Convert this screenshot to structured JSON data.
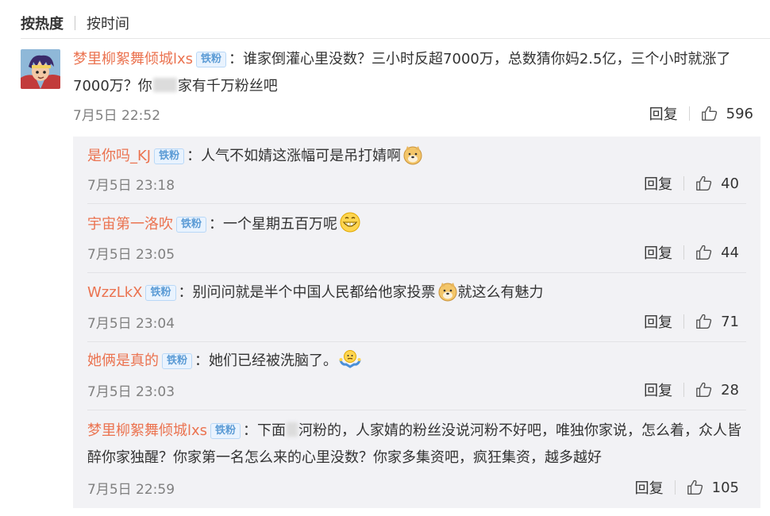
{
  "sort": {
    "hot": "按热度",
    "time": "按时间"
  },
  "main": {
    "avatar_icon": "anime-character-avatar",
    "username": "梦里柳絮舞倾城lxs",
    "badge": "铁粉",
    "text_a": "谁家倒灌心里没数？三小时反超7000万，总数猜你妈2.5亿，三个小时就涨了7000万？你",
    "text_b": "家有千万粉丝吧",
    "date": "7月5日 22:52",
    "reply_label": "回复",
    "likes": "596"
  },
  "replies": [
    {
      "username": "是你吗_KJ",
      "badge": "铁粉",
      "text": "人气不如婧这涨幅可是吊打婧啊",
      "emoji": "doge-emoji",
      "date": "7月5日 23:18",
      "reply_label": "回复",
      "likes": "40"
    },
    {
      "username": "宇宙第一洛吹",
      "badge": "铁粉",
      "text": "一个星期五百万呢",
      "emoji": "grin-emoji",
      "date": "7月5日 23:05",
      "reply_label": "回复",
      "likes": "44"
    },
    {
      "username": "WzzLkX",
      "badge": "铁粉",
      "text": "别问问就是半个中国人民都给他家投票",
      "text_after": "就这么有魅力",
      "emoji": "doge-emoji",
      "date": "7月5日 23:04",
      "reply_label": "回复",
      "likes": "71"
    },
    {
      "username": "她俩是真的",
      "badge": "铁粉",
      "text": "她们已经被洗脑了。",
      "emoji": "shrug-emoji",
      "date": "7月5日 23:03",
      "reply_label": "回复",
      "likes": "28"
    },
    {
      "username": "梦里柳絮舞倾城lxs",
      "badge": "铁粉",
      "text_a": "下面",
      "text_b": "河粉的，人家婧的粉丝没说河粉不好吧，唯独你家说，怎么着，众人皆醉你家独醒？你家第一名怎么来的心里没数？你家多集资吧，疯狂集资，越多越好",
      "date": "7月5日 22:59",
      "reply_label": "回复",
      "likes": "105"
    }
  ],
  "colors": {
    "username": "#eb7350",
    "badge_bg": "#e9f3fe",
    "badge_text": "#5b9bd5",
    "reply_bg": "#f2f2f5",
    "date": "#808080"
  }
}
